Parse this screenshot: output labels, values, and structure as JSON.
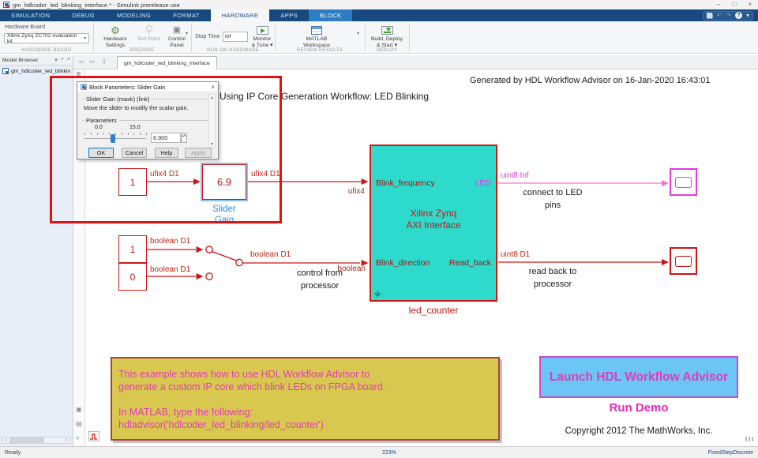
{
  "titlebar": {
    "title": "gm_hdlcoder_led_blinking_interface * - Simulink prerelease use"
  },
  "icons": {
    "minimize": "–",
    "maximize": "□",
    "close": "×",
    "undo": "↶",
    "redo": "↷",
    "help": "?",
    "dropdown": "▾",
    "back": "⇦",
    "forward": "⇨",
    "up": "⇧",
    "breadcrumb_toggle": "⊕",
    "collapse": "«",
    "prev": "‹",
    "next": "›",
    "pin": "+",
    "panel_menu": "▾",
    "panel_close": "×",
    "scroll_up": "▴",
    "scroll_down": "▾",
    "spin": "▴▾",
    "camera": "▣",
    "legend": "▤"
  },
  "ribbon": {
    "tabs": [
      {
        "label": "SIMULATION"
      },
      {
        "label": "DEBUG"
      },
      {
        "label": "MODELING"
      },
      {
        "label": "FORMAT"
      },
      {
        "label": "HARDWARE"
      },
      {
        "label": "APPS"
      },
      {
        "label": "BLOCK"
      }
    ],
    "hardware_board": {
      "label": "Hardware Board",
      "value": "Xilinx Zynq ZC702 evaluation kit",
      "group_label": "HARDWARE BOARD"
    },
    "prepare": {
      "hardware_settings": "Hardware Settings",
      "test_point": "Test Point",
      "control_panel": "Control Panel",
      "group_label": "PREPARE"
    },
    "run_on_hardware": {
      "stop_time_label": "Stop Time",
      "stop_time_value": "inf",
      "monitor_tune": "Monitor\n& Tune ▾",
      "group_label": "RUN ON HARDWARE"
    },
    "review_results": {
      "matlab_workspace": "MATLAB\nWorkspace",
      "group_label": "REVIEW RESULTS"
    },
    "deploy": {
      "build_deploy": "Build, Deploy\n& Start ▾",
      "group_label": "DEPLOY"
    }
  },
  "model_browser": {
    "title": "Model Browser",
    "tree_item": "gm_hdlcoder_led_blinking_i"
  },
  "canvas": {
    "tab_label": "gm_hdlcoder_led_blinking_interface",
    "generated_note": "Generated by HDL Workflow Advisor on 16-Jan-2020 16:43:01",
    "diagram_title": "Using IP Core Generation Workflow: LED Blinking"
  },
  "dialog": {
    "title": "Block Parameters: Slider Gain",
    "mask_header": "Slider Gain (mask) (link)",
    "description": "Move the slider to modify the scalar gain.",
    "parameters_label": "Parameters",
    "slider_min": "0.0",
    "slider_max": "15.0",
    "value": "6.900",
    "ok": "OK",
    "cancel": "Cancel",
    "help": "Help",
    "apply": "Apply"
  },
  "diagram": {
    "const_freq": "1",
    "gain_value": "6.9",
    "gain_label": "Slider\nGain",
    "sig_ufix4": "ufix4 D1",
    "port_ufix4": "ufix4",
    "in_blink_frequency": "Blink_frequency",
    "in_blink_direction": "Blink_direction",
    "out_led": "LED",
    "out_read_back": "Read_back",
    "axi_name": "Xilinx Zynq\nAXI Interface",
    "axi_label": "led_counter",
    "sig_uint8_inf": "uint8 Inf",
    "sig_uint8_d1": "uint8 D1",
    "const_on": "1",
    "const_off": "0",
    "sig_boolean": "boolean D1",
    "port_boolean": "boolean",
    "note_connect": "connect to\nLED pins",
    "note_read_back": "read back to\nprocessor",
    "note_control": "control from\nprocessor"
  },
  "notes": {
    "example_text": "This example shows how to use HDL Workflow Advisor to\ngenerate a custom IP core which blink LEDs on FPGA board.\n\nIn MATLAB, type the following:\n  hdladvisor('hdlcoder_led_blinking/led_counter')",
    "launch_button": "Launch HDL Workflow Advisor",
    "run_demo": "Run Demo",
    "copyright": "Copyright 2012 The MathWorks, Inc."
  },
  "statusbar": {
    "ready": "Ready",
    "zoom": "223%",
    "solver": "FixedStepDiscrete"
  }
}
